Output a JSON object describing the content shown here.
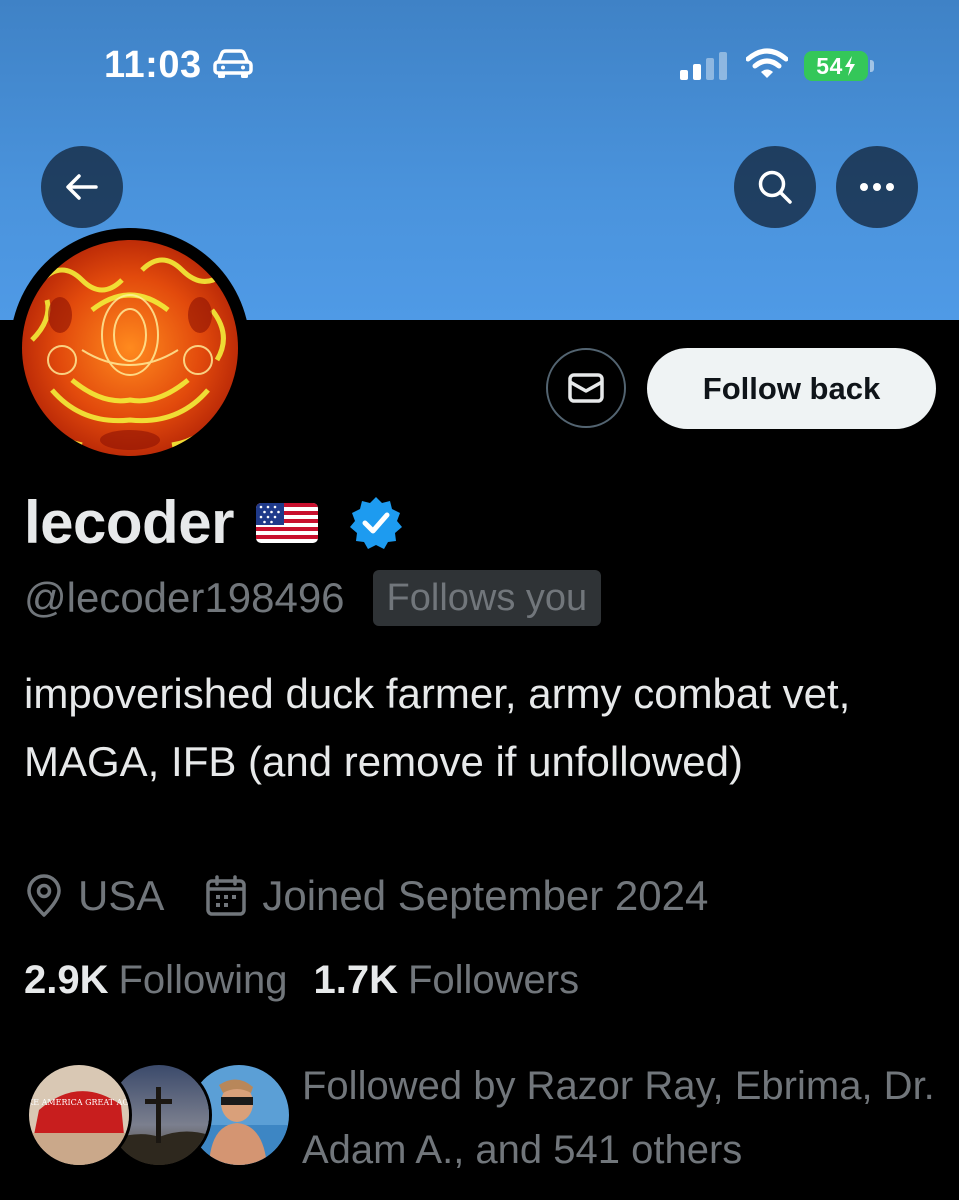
{
  "status_bar": {
    "time": "11:03",
    "battery": "54"
  },
  "colors": {
    "banner": "#4a93dc",
    "verified": "#1d9bf0",
    "battery": "#34c759",
    "muted_text": "#71767b",
    "follow_button_bg": "#eff3f4"
  },
  "icons": {
    "back": "arrow-left-icon",
    "search": "search-icon",
    "more": "more-horizontal-icon",
    "message": "envelope-icon",
    "verified": "verified-badge-icon",
    "location": "map-pin-icon",
    "joined": "calendar-icon"
  },
  "profile": {
    "display_name": "lecoder",
    "handle": "@lecoder198496",
    "follows_you": "Follows you",
    "bio": "impoverished duck farmer, army combat vet, MAGA, IFB (and remove if unfollowed)",
    "location": "USA",
    "joined": "Joined September 2024"
  },
  "actions": {
    "follow_back": "Follow back"
  },
  "stats": {
    "following_count": "2.9K",
    "following_label": "Following",
    "followers_count": "1.7K",
    "followers_label": "Followers"
  },
  "followed_by": {
    "text": "Followed by Razor Ray, Ebrima, Dr. Adam A., and 541 others",
    "avatar1_text": "MAKE AMERICA GREAT AGAIN"
  }
}
